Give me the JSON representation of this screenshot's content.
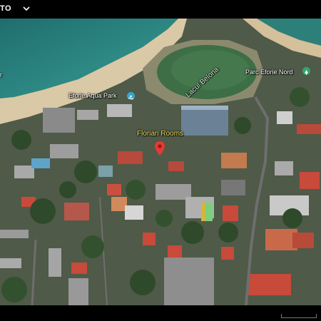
{
  "header": {
    "brand": "TO",
    "menu_icon": "chevron-down-icon"
  },
  "map": {
    "labels": {
      "aqua_park": "Eforie Aqua Park",
      "lake": "Lacul Belona",
      "park": "Parc Eforie Nord",
      "hotel": "Florian Rooms",
      "left_edge": "r"
    },
    "icons": {
      "aqua_park": "water-park-icon",
      "park": "park-icon",
      "hotel": "location-pin-icon"
    },
    "colors": {
      "sea": "#2f8a85",
      "sand": "#d9c9a6",
      "lake": "#3d6e45",
      "hotel_label": "#f2e066",
      "pin": "#e53935",
      "park_icon": "#2fa86b",
      "aqua_icon": "#36a6c9"
    }
  },
  "footer": {
    "scale_bar": "scale-bar"
  }
}
